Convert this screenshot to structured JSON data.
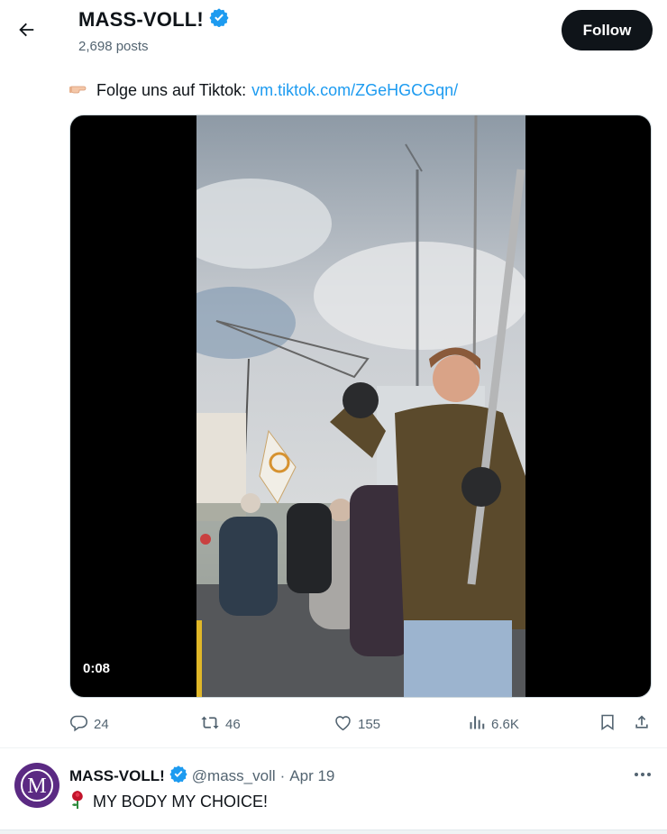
{
  "header": {
    "name": "MASS-VOLL!",
    "posts": "2,698 posts",
    "follow_label": "Follow"
  },
  "tweet": {
    "text": "Folge uns auf Tiktok:",
    "link": "vm.tiktok.com/ZGeHGCGqn/",
    "video_time": "0:08"
  },
  "stats": {
    "replies": "24",
    "reposts": "46",
    "likes": "155",
    "views": "6.6K"
  },
  "reply": {
    "name": "MASS-VOLL!",
    "handle": "@mass_voll",
    "sep": "·",
    "date": "Apr 19",
    "text": "MY BODY MY CHOICE!"
  },
  "icons": [
    "back-arrow-icon",
    "verified-badge-icon",
    "pointing-hand-icon",
    "reply-icon",
    "repost-icon",
    "like-icon",
    "views-icon",
    "bookmark-icon",
    "share-icon",
    "more-icon",
    "rose-icon"
  ],
  "colors": {
    "link": "#1d9bf0",
    "verified": "#1d9bf0",
    "muted": "#536471",
    "avatar": "#5b2a83"
  }
}
